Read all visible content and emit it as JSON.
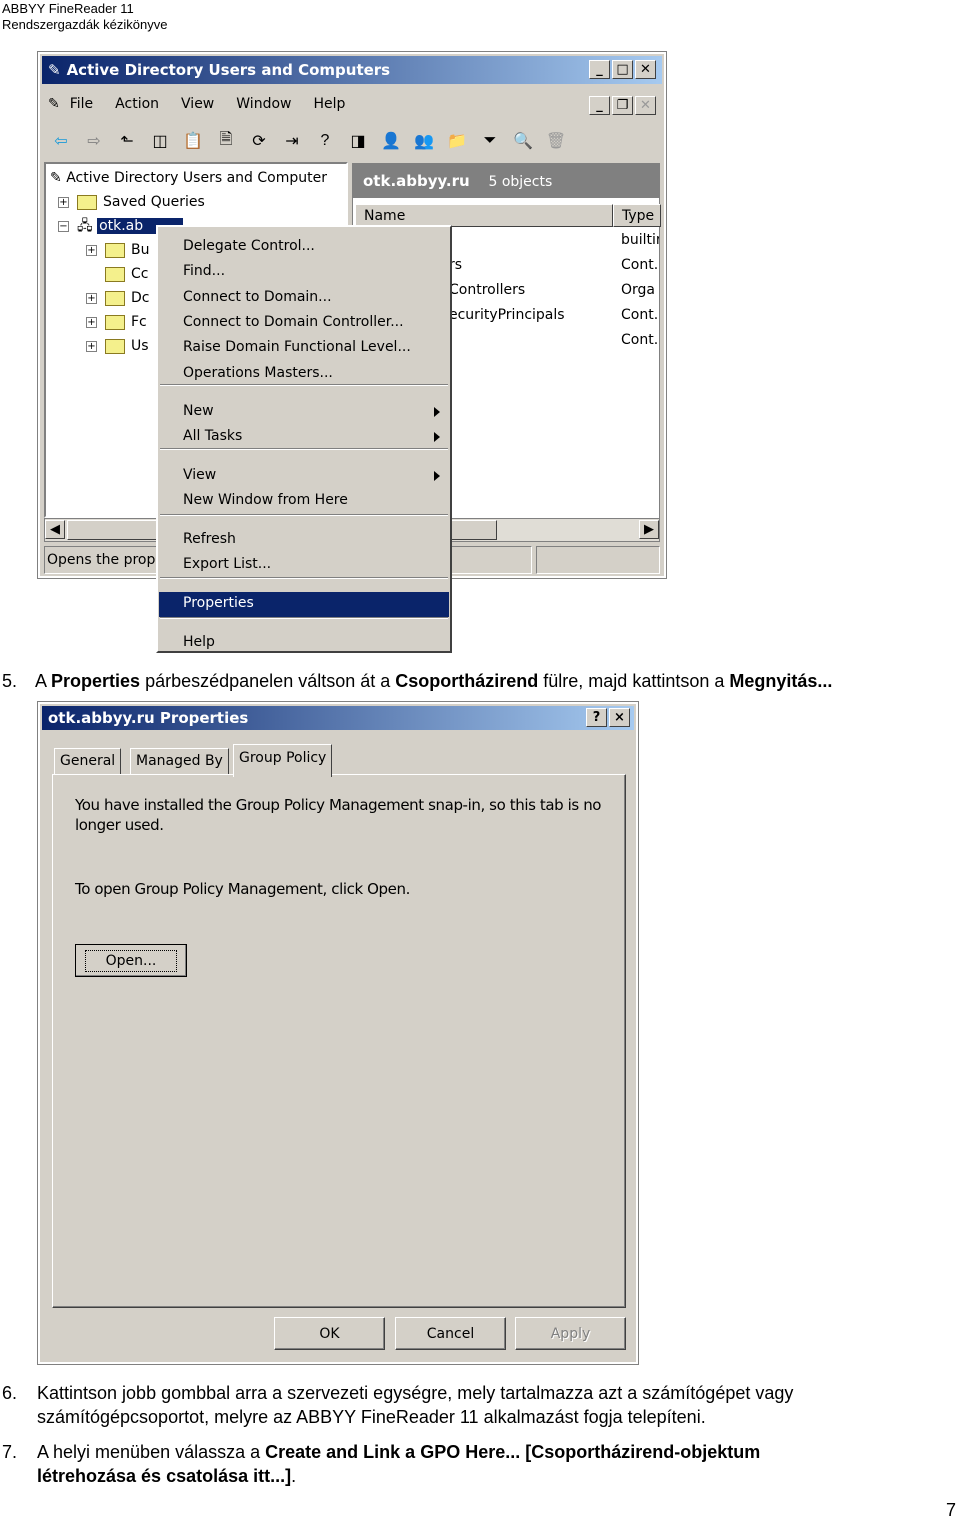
{
  "header": {
    "line1": "ABBYY FineReader 11",
    "line2": "Rendszergazdák kézikönyve"
  },
  "aduc": {
    "title": "Active Directory Users and Computers",
    "menu": [
      "File",
      "Action",
      "View",
      "Window",
      "Help"
    ],
    "tree_root": "Active Directory Users and Computer",
    "tree": [
      "Saved Queries",
      "otk.ab",
      "Bu",
      "Cc",
      "Dc",
      "Fc",
      "Us"
    ],
    "pane_title": "otk.abbyy.ru",
    "pane_count": "5 objects",
    "columns": [
      "Name",
      "Type"
    ],
    "rows": [
      {
        "name": "",
        "type": "builtir"
      },
      {
        "name": "rs",
        "type": "Cont."
      },
      {
        "name": "Controllers",
        "type": "Orga"
      },
      {
        "name": "ecurityPrincipals",
        "type": "Cont."
      },
      {
        "name": "",
        "type": "Cont."
      }
    ],
    "status": "Opens the prop"
  },
  "context_menu": {
    "items": [
      "Delegate Control...",
      "Find...",
      "Connect to Domain...",
      "Connect to Domain Controller...",
      "Raise Domain Functional Level...",
      "Operations Masters...",
      "New",
      "All Tasks",
      "View",
      "New Window from Here",
      "Refresh",
      "Export List...",
      "Properties",
      "Help"
    ],
    "selected": "Properties"
  },
  "step5": {
    "num": "5.",
    "t1": "A ",
    "b1": "Properties",
    "t2": " párbeszédpanelen váltson át a ",
    "b2": "Csoportházirend",
    "t3": " fülre, majd kattintson a ",
    "b3": "Megnyitás..."
  },
  "props": {
    "title": "otk.abbyy.ru Properties",
    "help": "?",
    "close": "×",
    "tabs": [
      "General",
      "Managed By",
      "Group Policy"
    ],
    "active_tab": "Group Policy",
    "msg1": "You have installed the Group Policy Management snap-in, so this tab is no",
    "msg1b": "longer used.",
    "msg2": "To open Group Policy Management, click Open.",
    "open": "Open...",
    "ok": "OK",
    "cancel": "Cancel",
    "apply": "Apply"
  },
  "step6": {
    "num": "6.",
    "l1": "Kattintson jobb gombbal arra a szervezeti egységre, mely tartalmazza azt a számítógépet vagy",
    "l2": "számítógépcsoportot, melyre az ABBYY FineReader 11 alkalmazást fogja telepíteni."
  },
  "step7": {
    "num": "7.",
    "t1": "A helyi menüben válassza a ",
    "b1": "Create and Link a GPO Here... [Csoportházirend-objektum",
    "b2": "létrehozása és csatolása itt...]",
    "t2": "."
  },
  "page_number": "7",
  "colors": {
    "title_bar": "#0a246a",
    "selection": "#0a246a",
    "face": "#d4d0c8"
  }
}
